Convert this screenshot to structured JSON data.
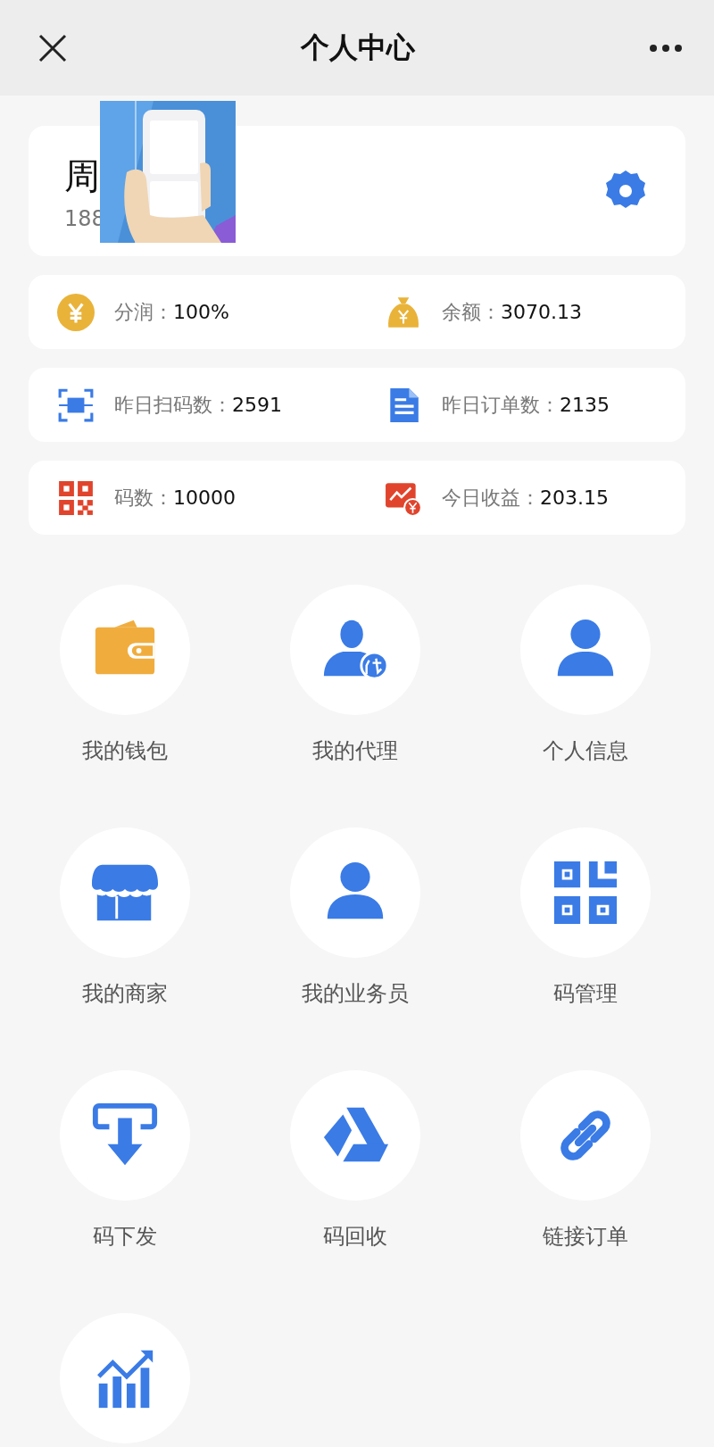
{
  "header": {
    "title": "个人中心"
  },
  "profile": {
    "name": "周",
    "phone": "188"
  },
  "stats": [
    {
      "kind": "yen-coin",
      "label": "分润：",
      "value": "100%"
    },
    {
      "kind": "money-bag",
      "label": "余额：",
      "value": "3070.13"
    },
    {
      "kind": "scan",
      "label": "昨日扫码数：",
      "value": "2591"
    },
    {
      "kind": "document",
      "label": "昨日订单数：",
      "value": "2135"
    },
    {
      "kind": "qr-code",
      "label": "码数：",
      "value": "10000"
    },
    {
      "kind": "earnings",
      "label": "今日收益：",
      "value": "203.15"
    }
  ],
  "menu": [
    {
      "kind": "wallet",
      "label": "我的钱包"
    },
    {
      "kind": "agent",
      "label": "我的代理"
    },
    {
      "kind": "person",
      "label": "个人信息"
    },
    {
      "kind": "shop",
      "label": "我的商家"
    },
    {
      "kind": "person",
      "label": "我的业务员"
    },
    {
      "kind": "qr",
      "label": "码管理"
    },
    {
      "kind": "download",
      "label": "码下发"
    },
    {
      "kind": "triangle",
      "label": "码回收"
    },
    {
      "kind": "link",
      "label": "链接订单"
    },
    {
      "kind": "chart"
    }
  ]
}
